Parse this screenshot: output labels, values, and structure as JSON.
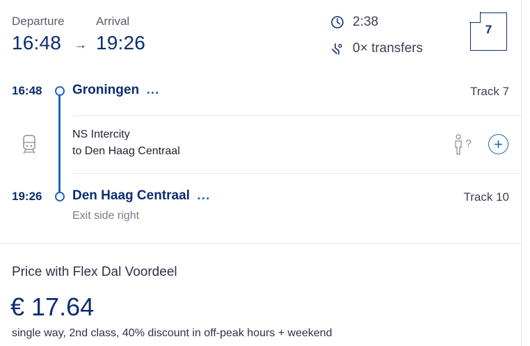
{
  "header": {
    "departure_label": "Departure",
    "arrival_label": "Arrival",
    "departure_time": "16:48",
    "arrow": "→",
    "arrival_time": "19:26",
    "duration": "2:38",
    "transfers": "0× transfers",
    "platform_badge": "7"
  },
  "stops": [
    {
      "time": "16:48",
      "name": "Groningen",
      "more": "...",
      "track": "Track 7"
    },
    {
      "time": "19:26",
      "name": "Den Haag Centraal",
      "more": "...",
      "track": "Track 10",
      "note": "Exit side right"
    }
  ],
  "service": {
    "line1": "NS Intercity",
    "line2": "to Den Haag Centraal",
    "crowd_unknown": "?",
    "expand_symbol": "+"
  },
  "price": {
    "label": "Price with Flex Dal Voordeel",
    "value": "€ 17.64",
    "description": "single way, 2nd class, 40% discount in off-peak hours + weekend"
  },
  "icons": {
    "duration": "clock-icon",
    "transfers": "no-transfer-icon",
    "train": "train-icon",
    "crowd": "person-icon"
  },
  "colors": {
    "primary": "#0c2c70",
    "accent": "#1b67c0",
    "divider": "#e6e6e9"
  }
}
